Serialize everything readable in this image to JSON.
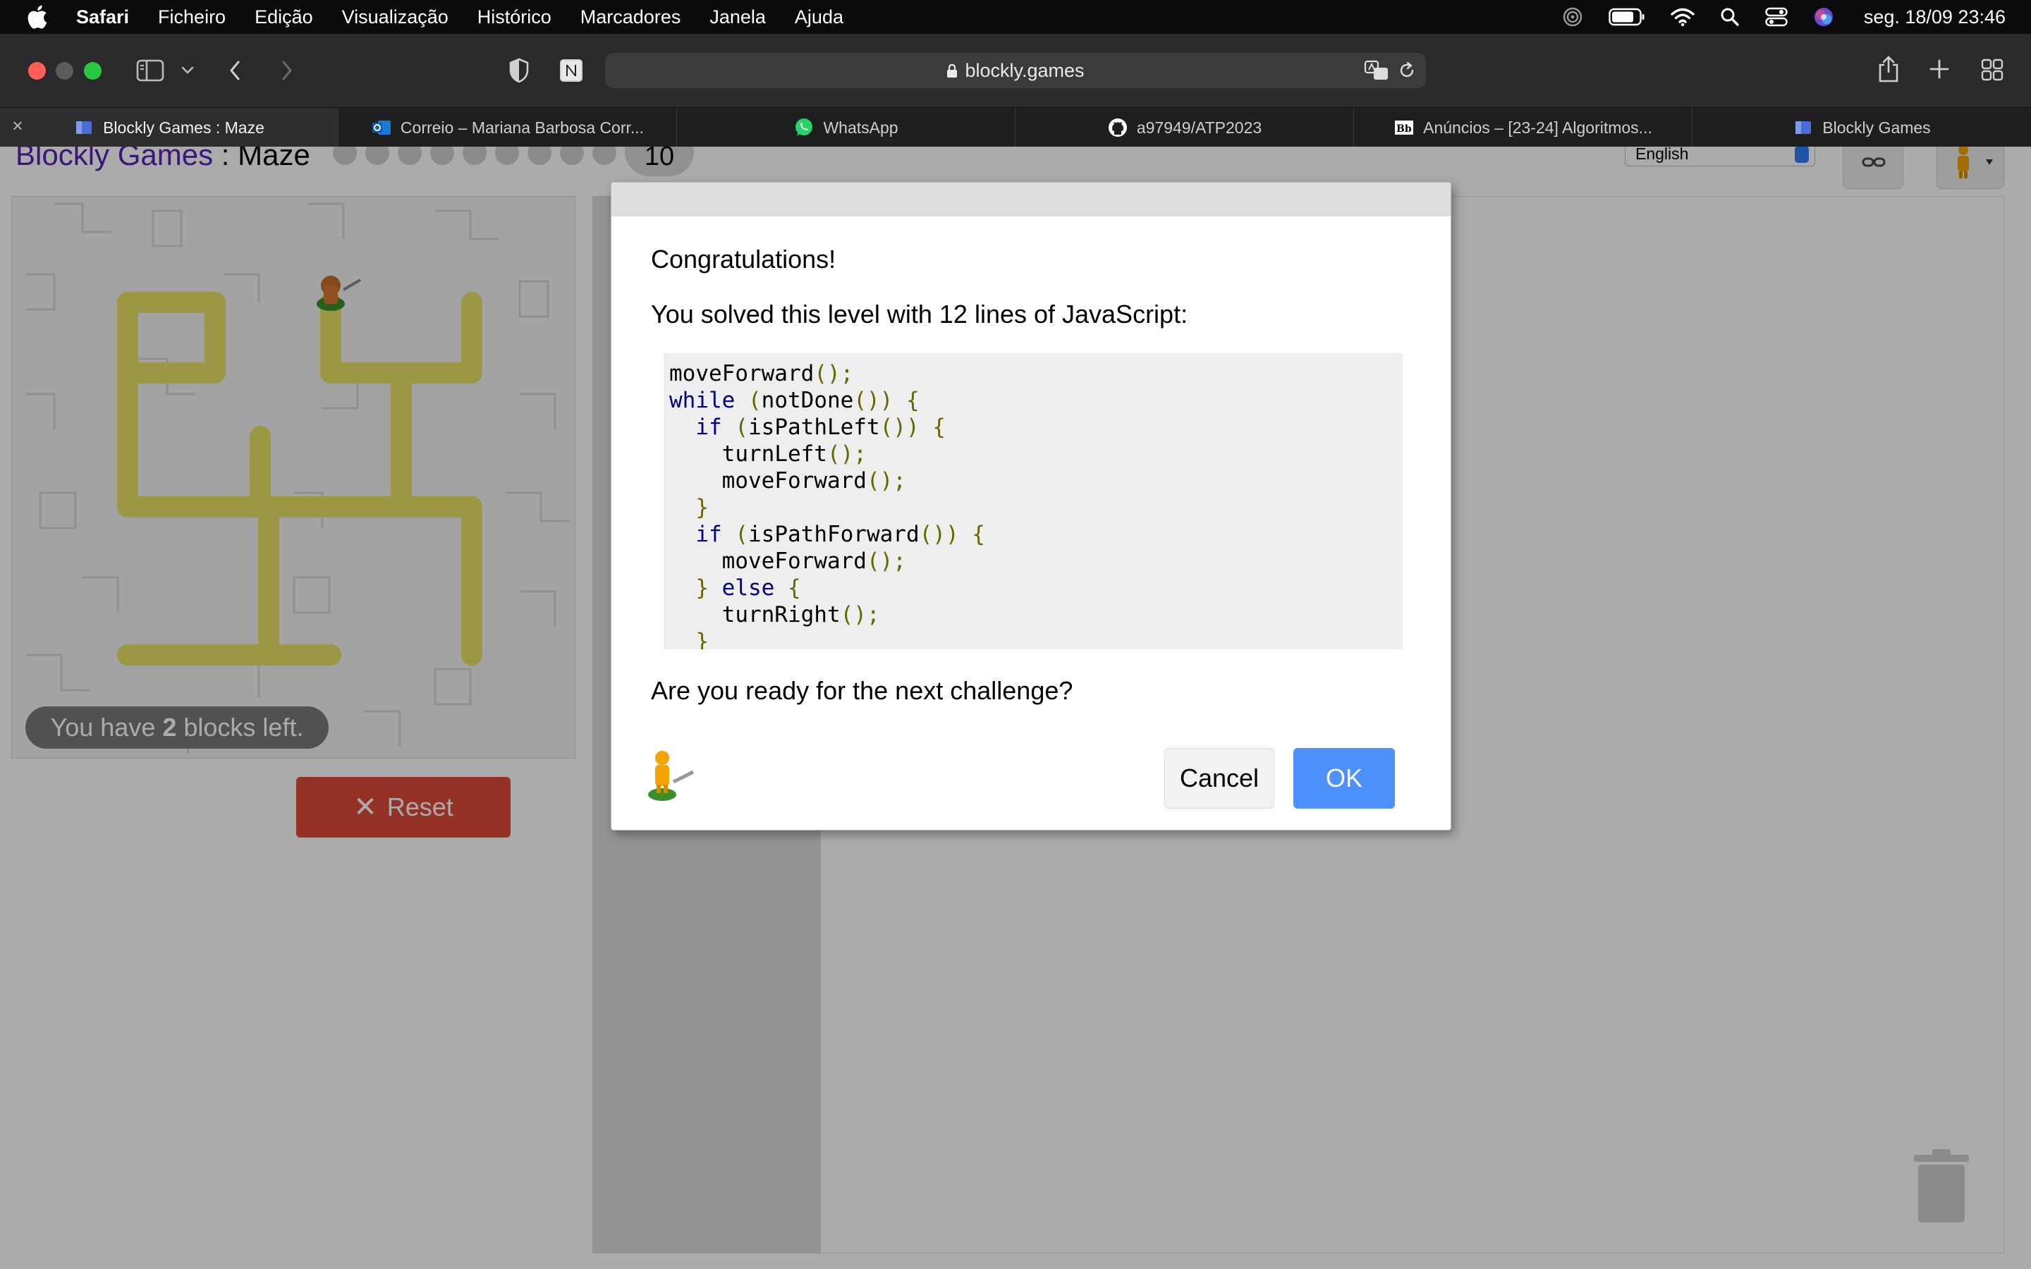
{
  "menubar": {
    "items": [
      "Safari",
      "Ficheiro",
      "Edição",
      "Visualização",
      "Histórico",
      "Marcadores",
      "Janela",
      "Ajuda"
    ],
    "clock": "seg. 18/09  23:46"
  },
  "browser": {
    "url": "blockly.games",
    "tabs": [
      {
        "title": "Blockly Games : Maze",
        "active": true
      },
      {
        "title": "Correio – Mariana Barbosa Corr..."
      },
      {
        "title": "WhatsApp"
      },
      {
        "title": "a97949/ATP2023"
      },
      {
        "title": "Anúncios – [23-24] Algoritmos..."
      },
      {
        "title": "Blockly Games"
      }
    ]
  },
  "game": {
    "title_link": "Blockly Games",
    "title_sep": " : ",
    "title_name": "Maze",
    "level": "10",
    "language": "English",
    "blocks_left_prefix": "You have ",
    "blocks_left_count": "2",
    "blocks_left_suffix": " blocks left.",
    "reset_label": "Reset"
  },
  "dialog": {
    "heading": "Congratulations!",
    "lines_msg": "You solved this level with 12 lines of JavaScript:",
    "question": "Are you ready for the next challenge?",
    "cancel_label": "Cancel",
    "ok_label": "OK"
  },
  "code": {
    "l1": "moveForward",
    "l2_kw": "while",
    "l2_fn": "notDone",
    "l3_kw": "if",
    "l3_fn": "isPathLeft",
    "l4": "turnLeft",
    "l5": "moveForward",
    "l7_kw": "if",
    "l7_fn": "isPathForward",
    "l8": "moveForward",
    "l9_kw": "else",
    "l10": "turnRight"
  },
  "colors": {
    "accent_blue": "#4d90fe",
    "reset_red": "#dd4b39",
    "link_purple": "#5722b3",
    "path_yellow": "#ece36a"
  }
}
